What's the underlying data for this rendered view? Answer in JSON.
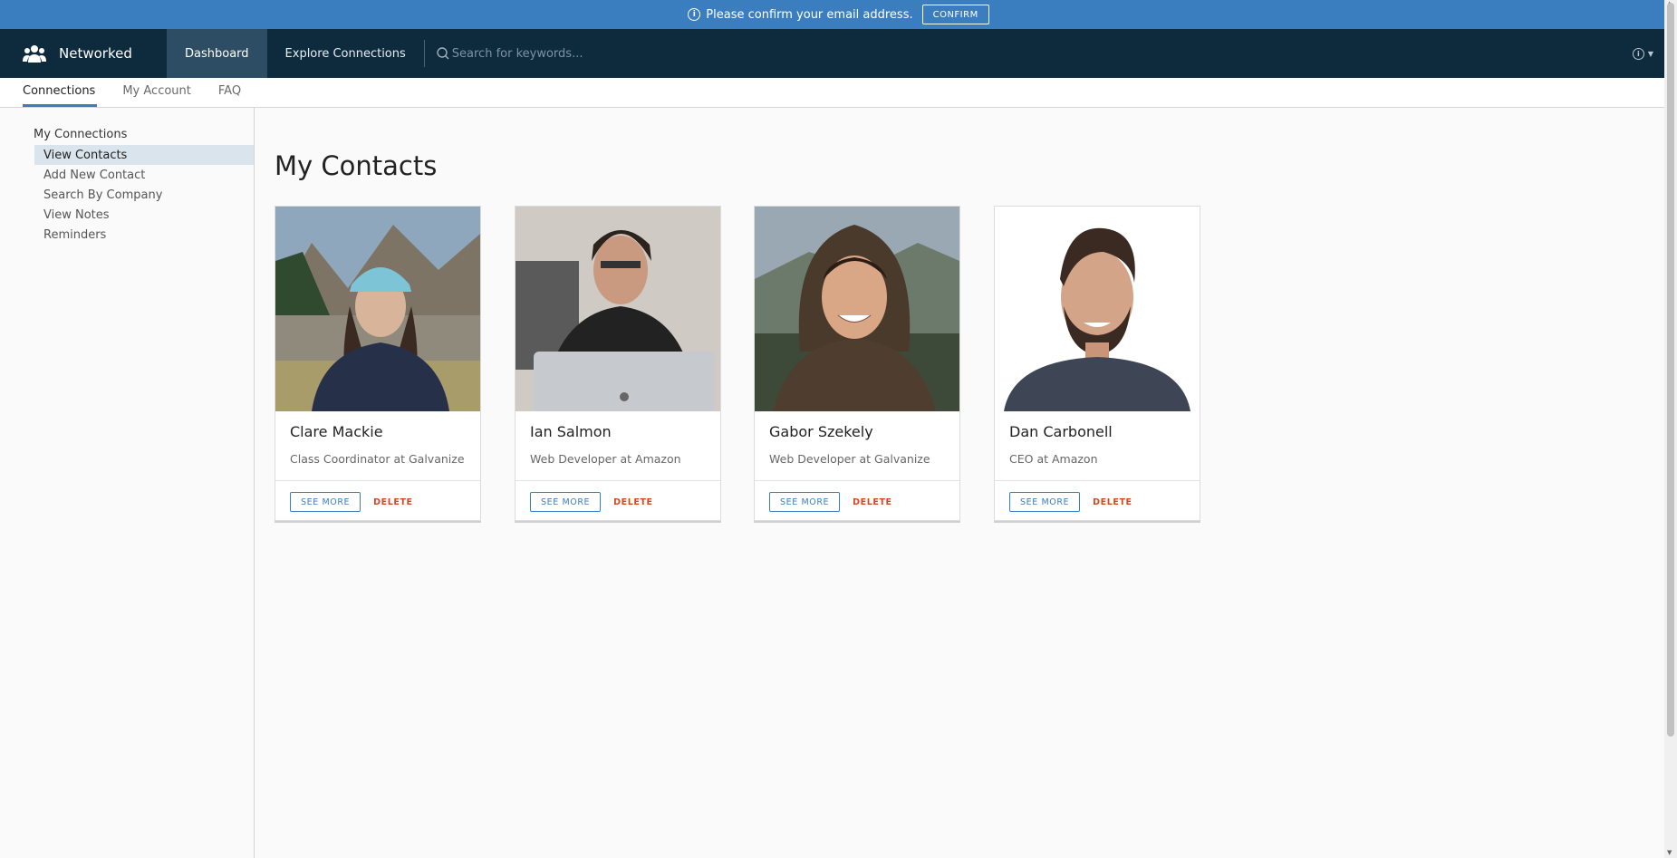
{
  "banner": {
    "message": "Please confirm your email address.",
    "confirm_label": "CONFIRM",
    "color": "#3b7ec0"
  },
  "header": {
    "brand": "Networked",
    "logo_icon": "people-group-icon",
    "tabs": [
      {
        "label": "Dashboard",
        "active": true
      },
      {
        "label": "Explore Connections",
        "active": false
      }
    ],
    "search": {
      "placeholder": "Search for keywords...",
      "value": ""
    },
    "help_icon": "info-icon",
    "background": "#0e2a3d"
  },
  "subnav": {
    "tabs": [
      {
        "label": "Connections",
        "active": true
      },
      {
        "label": "My Account",
        "active": false
      },
      {
        "label": "FAQ",
        "active": false
      }
    ]
  },
  "sidebar": {
    "heading": "My Connections",
    "items": [
      {
        "label": "View Contacts",
        "active": true
      },
      {
        "label": "Add New Contact",
        "active": false
      },
      {
        "label": "Search By Company",
        "active": false
      },
      {
        "label": "View Notes",
        "active": false
      },
      {
        "label": "Reminders",
        "active": false
      }
    ]
  },
  "main": {
    "title": "My Contacts",
    "contacts": [
      {
        "name": "Clare Mackie",
        "title": "Class Coordinator at Galvanize",
        "see_more": "SEE MORE",
        "delete": "DELETE"
      },
      {
        "name": "Ian Salmon",
        "title": "Web Developer at Amazon",
        "see_more": "SEE MORE",
        "delete": "DELETE"
      },
      {
        "name": "Gabor Szekely",
        "title": "Web Developer at Galvanize",
        "see_more": "SEE MORE",
        "delete": "DELETE"
      },
      {
        "name": "Dan Carbonell",
        "title": "CEO at Amazon",
        "see_more": "SEE MORE",
        "delete": "DELETE"
      }
    ]
  },
  "colors": {
    "accent": "#3b7ec0",
    "danger": "#d2491d"
  }
}
